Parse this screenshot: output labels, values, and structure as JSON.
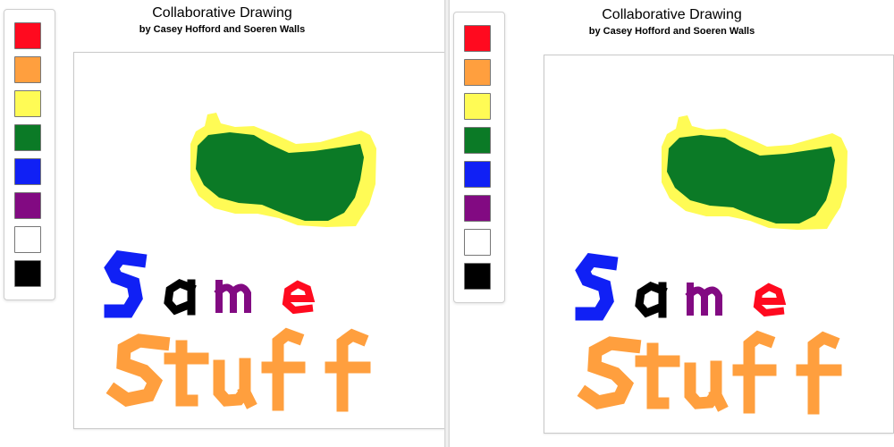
{
  "app": {
    "title": "Collaborative Drawing",
    "byline": "by Casey Hofford and Soeren Walls"
  },
  "palette": [
    {
      "name": "red",
      "color": "#ff0a1f"
    },
    {
      "name": "orange",
      "color": "#ff9f3e"
    },
    {
      "name": "yellow",
      "color": "#fffb55"
    },
    {
      "name": "green",
      "color": "#0b7a26"
    },
    {
      "name": "blue",
      "color": "#1020f5"
    },
    {
      "name": "purple",
      "color": "#820a82"
    },
    {
      "name": "white",
      "color": "#ffffff"
    },
    {
      "name": "black",
      "color": "#000000"
    }
  ]
}
